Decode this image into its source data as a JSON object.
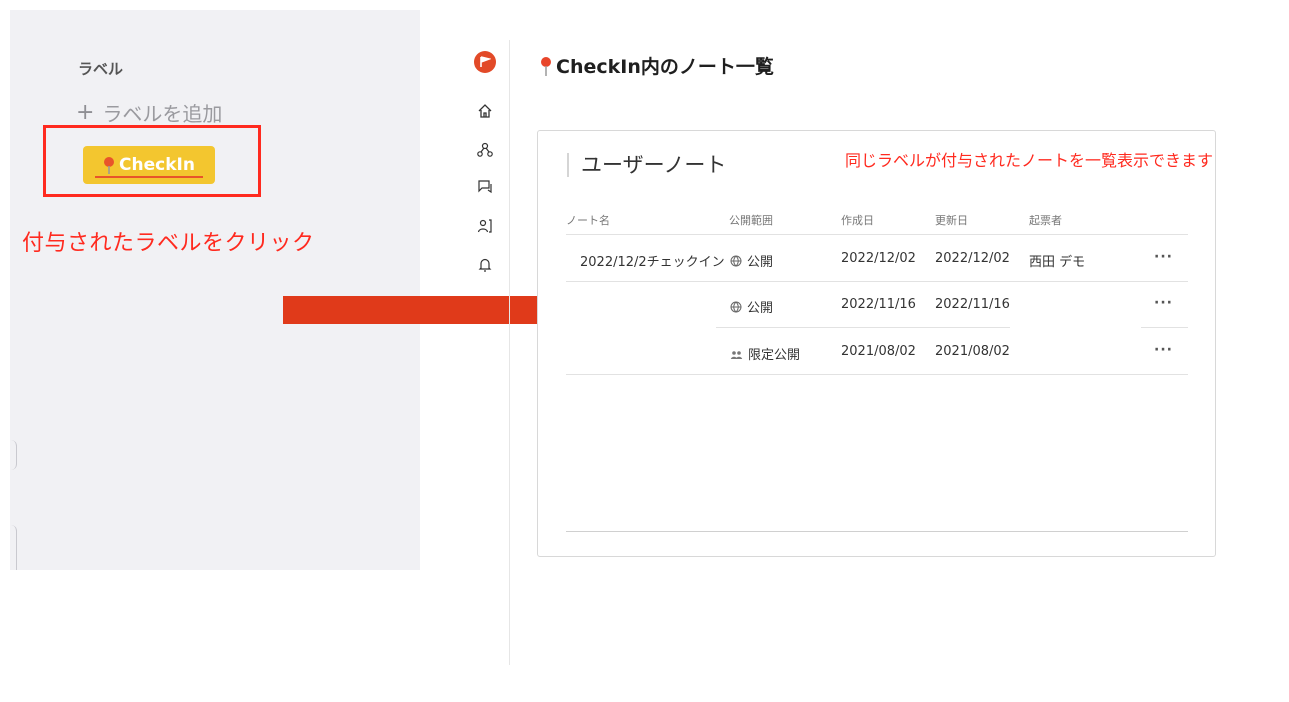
{
  "left_panel": {
    "label_heading": "ラベル",
    "add_label": "ラベルを追加",
    "chip_label": "CheckIn",
    "instruction": "付与されたラベルをクリック"
  },
  "nav": {
    "icons": [
      "logo-flag-icon",
      "home-icon",
      "network-icon",
      "chat-icon",
      "contacts-icon",
      "bell-icon"
    ]
  },
  "main": {
    "title": "CheckIn内のノート一覧",
    "section_title": "ユーザーノート",
    "annotation": "同じラベルが付与されたノートを一覧表示できます",
    "columns": [
      "ノート名",
      "公開範囲",
      "作成日",
      "更新日",
      "起票者"
    ],
    "rows": [
      {
        "name": "2022/12/2チェックイン",
        "visibility": "公開",
        "visibility_icon": "globe-icon",
        "created": "2022/12/02",
        "updated": "2022/12/02",
        "author": "西田 デモ",
        "more": "···"
      },
      {
        "name": "",
        "visibility": "公開",
        "visibility_icon": "globe-icon",
        "created": "2022/11/16",
        "updated": "2022/11/16",
        "author": "",
        "more": "···"
      },
      {
        "name": "",
        "visibility": "限定公開",
        "visibility_icon": "group-icon",
        "created": "2021/08/02",
        "updated": "2021/08/02",
        "author": "",
        "more": "···"
      }
    ]
  },
  "colors": {
    "accent": "#e24a28",
    "chip": "#f3c62f",
    "annotation": "#ff2a1f"
  }
}
